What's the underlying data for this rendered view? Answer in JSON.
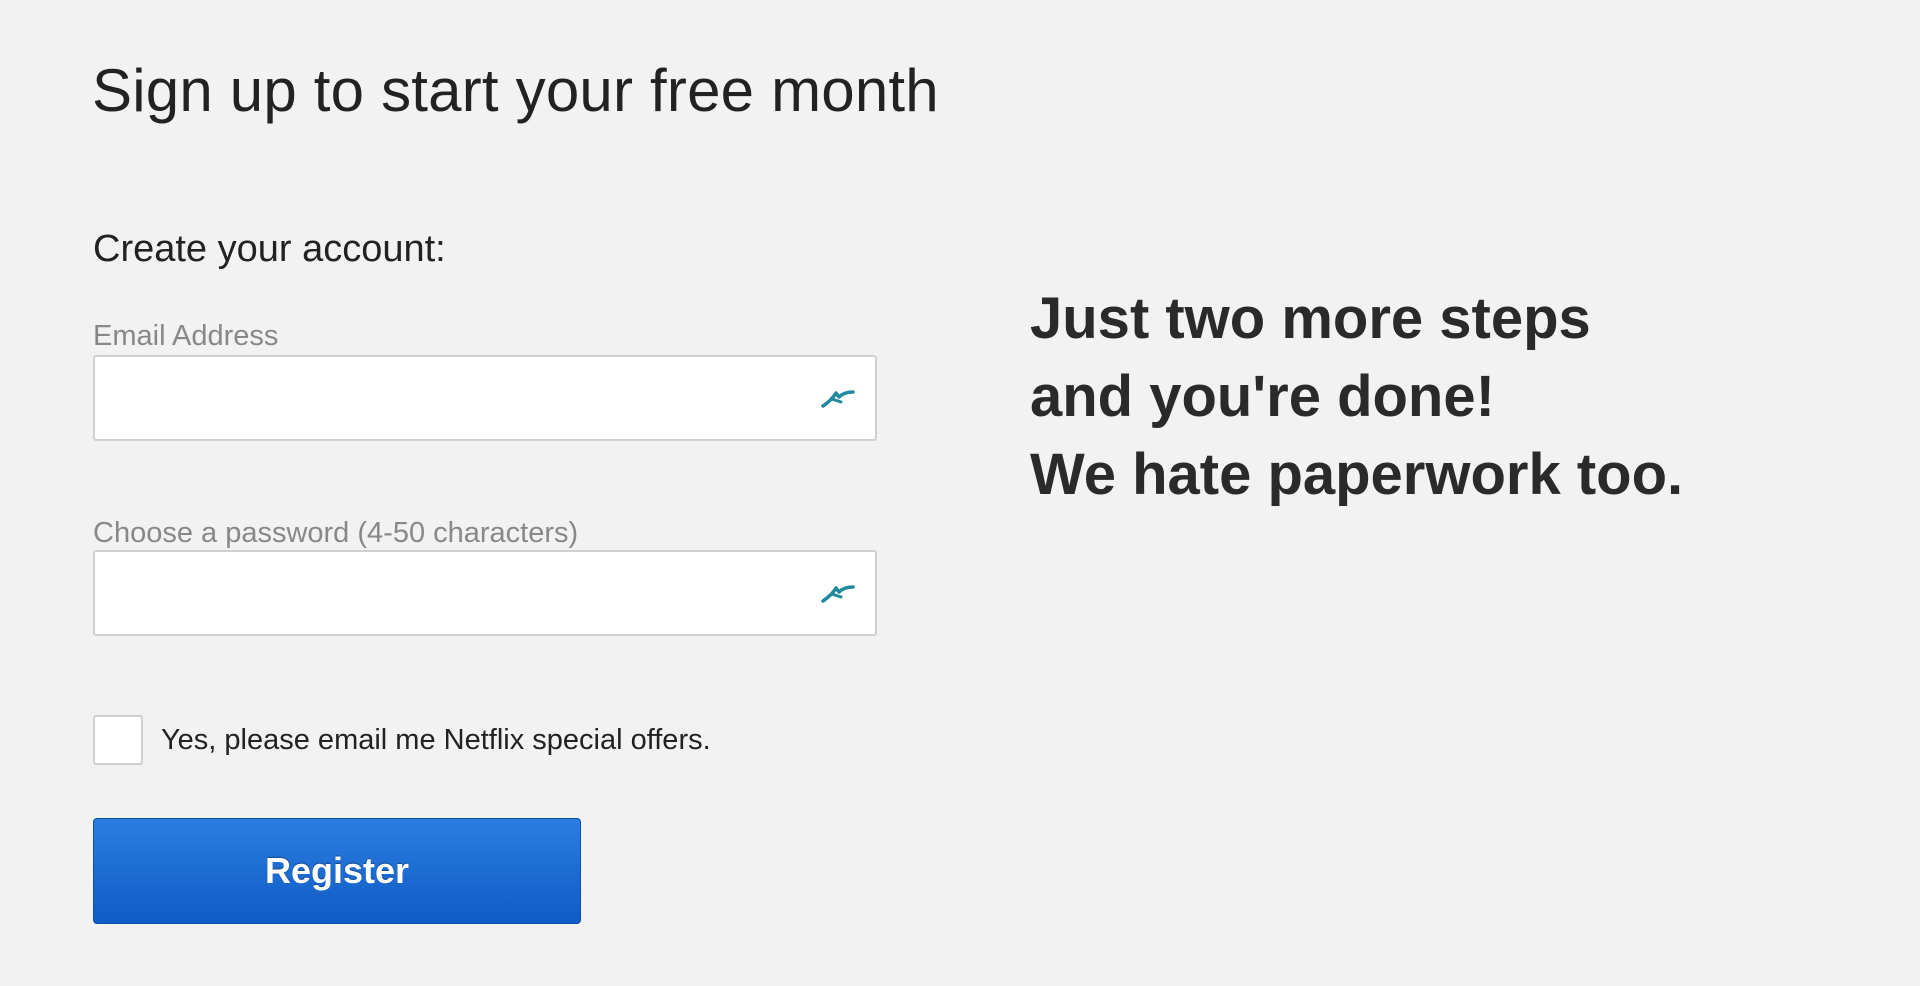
{
  "header": {
    "title": "Sign up to start your free month"
  },
  "form": {
    "section_label": "Create your account:",
    "email": {
      "label": "Email Address",
      "value": "",
      "placeholder": "",
      "icon": "password-manager-icon"
    },
    "password": {
      "label": "Choose a password (4-50 characters)",
      "value": "",
      "placeholder": "",
      "icon": "password-manager-icon"
    },
    "offers_checkbox": {
      "label": "Yes, please email me Netflix special offers.",
      "checked": false
    },
    "register_button": {
      "label": "Register",
      "color": "#1565d0"
    }
  },
  "promo": {
    "lines": [
      "Just two more steps",
      "and you're done!",
      "We hate paperwork too."
    ]
  },
  "colors": {
    "background": "#f2f2f2",
    "icon_accent": "#1f8a9e"
  }
}
